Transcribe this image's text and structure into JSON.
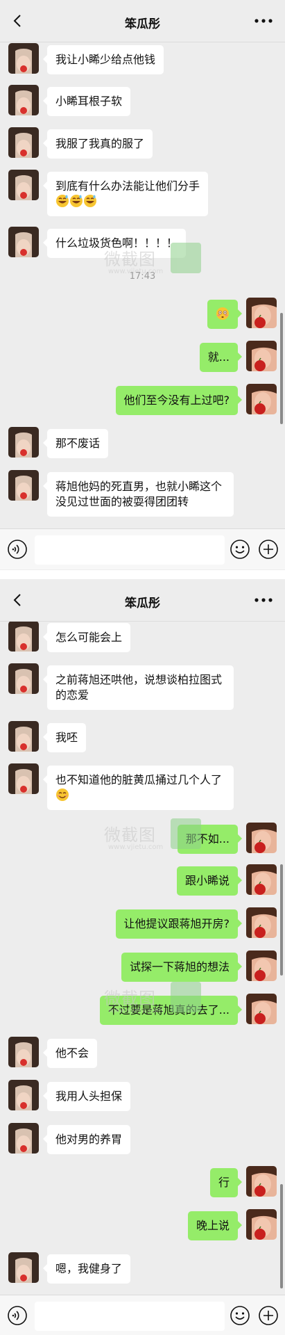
{
  "chat": {
    "title": "笨瓜彤",
    "timestamp": "17:43"
  },
  "top_messages": [
    {
      "side": "left",
      "text": "我让小睎少给点他钱"
    },
    {
      "side": "left",
      "text": "小睎耳根子软"
    },
    {
      "side": "left",
      "text": "我服了我真的服了"
    },
    {
      "side": "left",
      "text": "到底有什么办法能让他们分手",
      "emoji": "grinning-sweat-emoji x3"
    },
    {
      "side": "left",
      "text": "什么垃圾货色啊！！！！"
    },
    {
      "side": "right",
      "text": "",
      "emoji": "flushed-face-emoji"
    },
    {
      "side": "right",
      "text": "就..."
    },
    {
      "side": "right",
      "text": "他们至今没有上过吧?"
    },
    {
      "side": "left",
      "text": "那不废话"
    },
    {
      "side": "left",
      "text": "蒋旭他妈的死直男，也就小睎这个没见过世面的被耍得团团转"
    }
  ],
  "bottom_messages": [
    {
      "side": "left",
      "text": "怎么可能会上"
    },
    {
      "side": "left",
      "text": "之前蒋旭还哄他，说想谈柏拉图式的恋爱"
    },
    {
      "side": "left",
      "text": "我呸"
    },
    {
      "side": "left",
      "text": "也不知道他的脏黄瓜捅过几个人了",
      "emoji": "smile-emoji"
    },
    {
      "side": "right",
      "text": "那不如..."
    },
    {
      "side": "right",
      "text": "跟小睎说"
    },
    {
      "side": "right",
      "text": "让他提议跟蒋旭开房?"
    },
    {
      "side": "right",
      "text": "试探一下蒋旭的想法"
    },
    {
      "side": "right",
      "text": "不过要是蒋旭真的去了..."
    },
    {
      "side": "left",
      "text": "他不会"
    },
    {
      "side": "left",
      "text": "我用人头担保"
    },
    {
      "side": "left",
      "text": "他对男的养胃"
    },
    {
      "side": "right",
      "text": "行"
    },
    {
      "side": "right",
      "text": "晚上说"
    },
    {
      "side": "left",
      "text": "嗯，我健身了"
    }
  ],
  "watermark": {
    "title": "微截图",
    "url": "www.vjietu.com"
  },
  "icons": {
    "back": "chevron-left-icon",
    "more": "more-dots-icon",
    "voice": "voice-icon",
    "emoji": "emoji-icon",
    "plus": "plus-icon"
  },
  "colors": {
    "sent_bubble": "#95ec69",
    "received_bubble": "#ffffff",
    "background": "#ededed"
  }
}
